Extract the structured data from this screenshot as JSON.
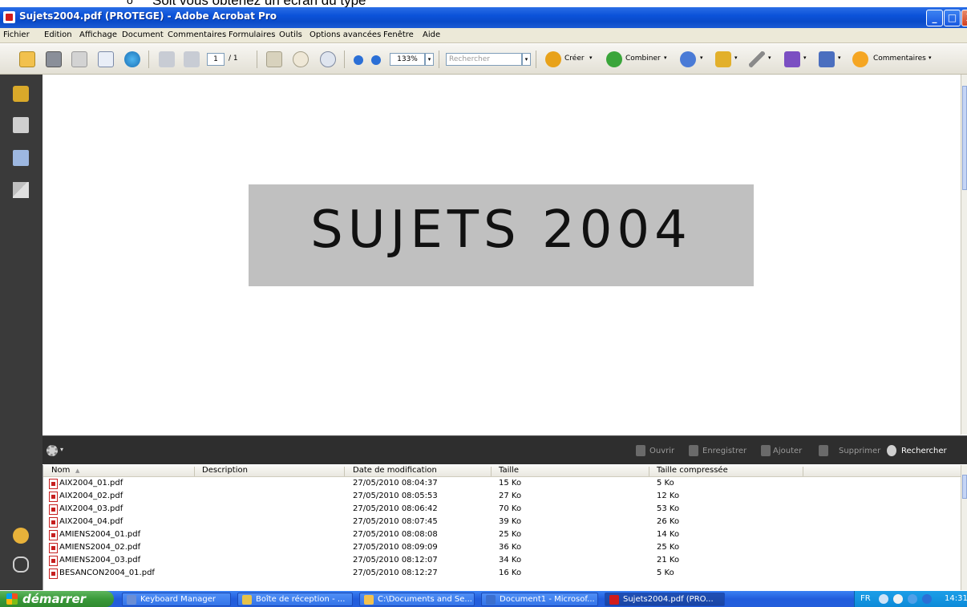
{
  "doc_fragment": {
    "bullet": "o",
    "text": "Soit vous obtenez un écran du type"
  },
  "window": {
    "title": "Sujets2004.pdf (PROTEGE) - Adobe Acrobat Pro",
    "minimize": "_",
    "maximize": "□",
    "close": "X"
  },
  "menu": [
    "Fichier",
    "Edition",
    "Affichage",
    "Document",
    "Commentaires",
    "Formulaires",
    "Outils",
    "Options avancées",
    "Fenêtre",
    "Aide"
  ],
  "toolbar": {
    "page_current": "1",
    "page_total": "/ 1",
    "zoom": "133%",
    "search_placeholder": "Rechercher",
    "creer": "Créer",
    "combiner": "Combiner",
    "commentaires": "Commentaires",
    "dropdown_arrow": "▾",
    "icons": [
      "open-folder-icon",
      "print-icon",
      "save-icon",
      "email-icon",
      "share-icon",
      "prev-page-icon",
      "next-page-icon",
      "select-tool-icon",
      "hand-tool-icon",
      "zoom-tool-icon",
      "zoom-out-icon",
      "zoom-in-icon",
      "create-icon",
      "combine-icon",
      "stamp-icon",
      "lock-icon",
      "sign-icon",
      "forms-icon",
      "multimedia-icon",
      "comment-icon"
    ],
    "colors": {
      "create": "#e8a21a",
      "combine": "#3aa53a",
      "lock": "#e2b02b",
      "forms": "#7b4fc2",
      "comment": "#f5a623"
    }
  },
  "leftnav": {
    "icons": [
      "lock-icon",
      "pages-icon",
      "bookmarks-icon",
      "signatures-icon",
      "comments-icon",
      "attachments-icon"
    ]
  },
  "document": {
    "cover_text": "SUJETS 2004"
  },
  "portfolio_bar": {
    "gear_caret": "▾",
    "ouvrir": "Ouvrir",
    "enregistrer": "Enregistrer",
    "ajouter": "Ajouter",
    "supprimer": "Supprimer",
    "rechercher": "Rechercher"
  },
  "file_list": {
    "columns": [
      "Nom",
      "Description",
      "Date de modification",
      "Taille",
      "Taille compressée"
    ],
    "sort_indicator": "▲",
    "rows": [
      {
        "name": "AIX2004_01.pdf",
        "description": "",
        "date": "27/05/2010 08:04:37",
        "size": "15 Ko",
        "compressed": "5 Ko"
      },
      {
        "name": "AIX2004_02.pdf",
        "description": "",
        "date": "27/05/2010 08:05:53",
        "size": "27 Ko",
        "compressed": "12 Ko"
      },
      {
        "name": "AIX2004_03.pdf",
        "description": "",
        "date": "27/05/2010 08:06:42",
        "size": "70 Ko",
        "compressed": "53 Ko"
      },
      {
        "name": "AIX2004_04.pdf",
        "description": "",
        "date": "27/05/2010 08:07:45",
        "size": "39 Ko",
        "compressed": "26 Ko"
      },
      {
        "name": "AMIENS2004_01.pdf",
        "description": "",
        "date": "27/05/2010 08:08:08",
        "size": "25 Ko",
        "compressed": "14 Ko"
      },
      {
        "name": "AMIENS2004_02.pdf",
        "description": "",
        "date": "27/05/2010 08:09:09",
        "size": "36 Ko",
        "compressed": "25 Ko"
      },
      {
        "name": "AMIENS2004_03.pdf",
        "description": "",
        "date": "27/05/2010 08:12:07",
        "size": "34 Ko",
        "compressed": "21 Ko"
      },
      {
        "name": "BESANCON2004_01.pdf",
        "description": "",
        "date": "27/05/2010 08:12:27",
        "size": "16 Ko",
        "compressed": "5 Ko"
      }
    ]
  },
  "taskbar": {
    "start": "démarrer",
    "tasks": [
      {
        "label": "Keyboard Manager",
        "icon": "keyboard-manager-icon",
        "active": false
      },
      {
        "label": "Boîte de réception - ...",
        "icon": "outlook-icon",
        "active": false
      },
      {
        "label": "C:\\Documents and Se...",
        "icon": "folder-icon",
        "active": false
      },
      {
        "label": "Document1 - Microsof...",
        "icon": "word-icon",
        "active": false
      },
      {
        "label": "Sujets2004.pdf (PRO...",
        "icon": "acrobat-icon",
        "active": true
      }
    ],
    "lang": "FR",
    "clock": "14:31"
  }
}
